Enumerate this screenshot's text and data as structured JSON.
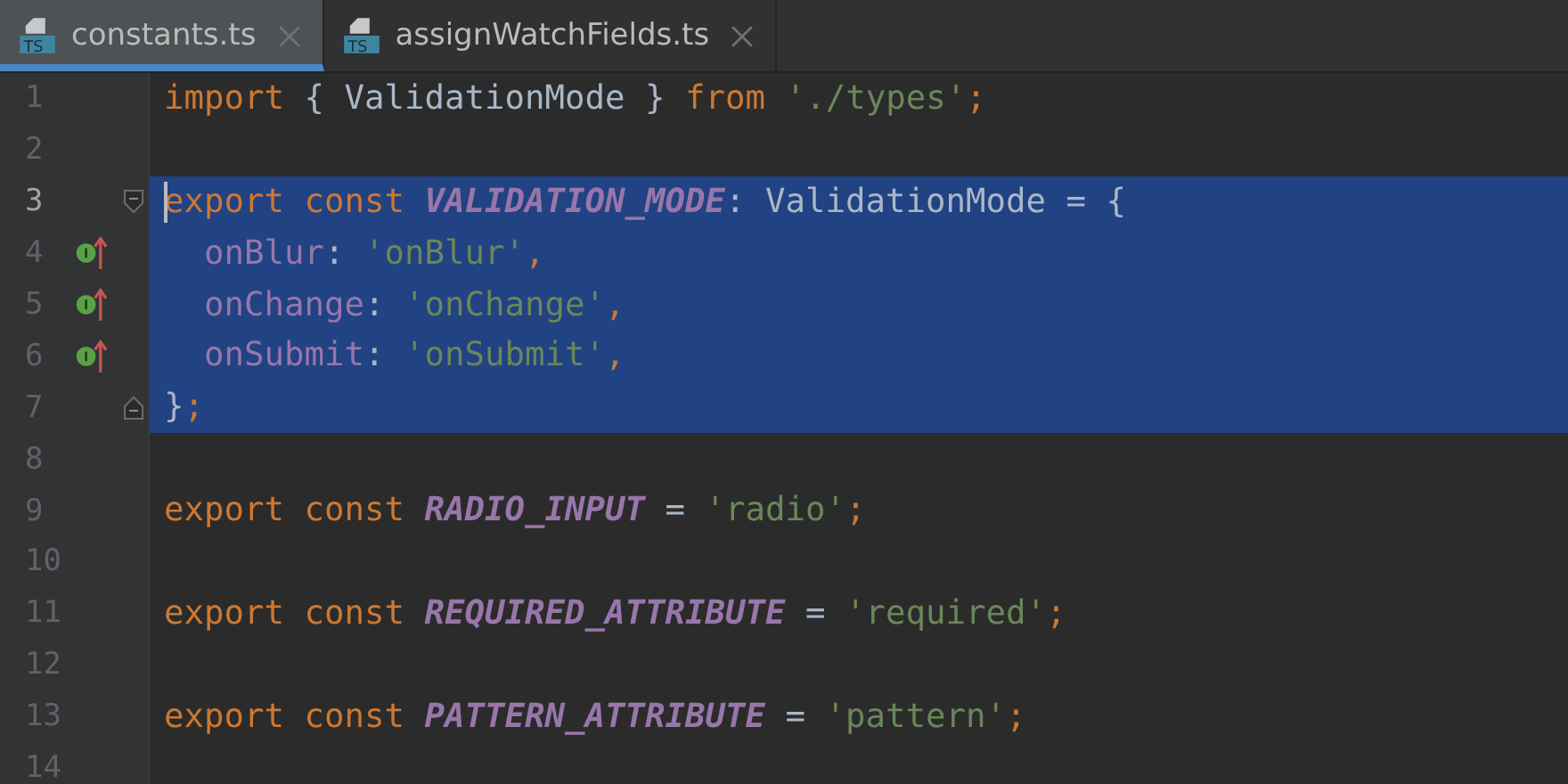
{
  "tabs": [
    {
      "label": "constants.ts",
      "icon_text": "TS",
      "selected": true
    },
    {
      "label": "assignWatchFields.ts",
      "icon_text": "TS",
      "selected": false
    }
  ],
  "lines": [
    {
      "number": "1",
      "current": false,
      "selected": false,
      "tokens": [
        {
          "kind": "keyword",
          "text": "import "
        },
        {
          "kind": "plain",
          "text": "{ ValidationMode } "
        },
        {
          "kind": "keyword",
          "text": "from "
        },
        {
          "kind": "string",
          "text": "'./types'"
        },
        {
          "kind": "keyword",
          "text": ";"
        }
      ]
    },
    {
      "number": "2",
      "current": false,
      "selected": false
    },
    {
      "number": "3",
      "current": true,
      "selected": true,
      "cursor": true,
      "fold_start": true,
      "tokens": [
        {
          "kind": "keyword",
          "text": "export const "
        },
        {
          "kind": "constant",
          "text": "VALIDATION_MODE"
        },
        {
          "kind": "plain",
          "text": ": ValidationMode = {"
        }
      ]
    },
    {
      "number": "4",
      "current": false,
      "selected": true,
      "marker": true,
      "tokens": [
        {
          "kind": "property",
          "text": "  onBlur"
        },
        {
          "kind": "plain",
          "text": ": "
        },
        {
          "kind": "string",
          "text": "'onBlur'"
        },
        {
          "kind": "keyword",
          "text": ","
        }
      ]
    },
    {
      "number": "5",
      "current": false,
      "selected": true,
      "marker": true,
      "tokens": [
        {
          "kind": "property",
          "text": "  onChange"
        },
        {
          "kind": "plain",
          "text": ": "
        },
        {
          "kind": "string",
          "text": "'onChange'"
        },
        {
          "kind": "keyword",
          "text": ","
        }
      ]
    },
    {
      "number": "6",
      "current": false,
      "selected": true,
      "marker": true,
      "tokens": [
        {
          "kind": "property",
          "text": "  onSubmit"
        },
        {
          "kind": "plain",
          "text": ": "
        },
        {
          "kind": "string",
          "text": "'onSubmit'"
        },
        {
          "kind": "keyword",
          "text": ","
        }
      ]
    },
    {
      "number": "7",
      "current": false,
      "selected": true,
      "fold_end": true,
      "tokens": [
        {
          "kind": "plain",
          "text": "}"
        },
        {
          "kind": "keyword",
          "text": ";"
        }
      ]
    },
    {
      "number": "8",
      "current": false,
      "selected": false
    },
    {
      "number": "9",
      "current": false,
      "selected": false,
      "tokens": [
        {
          "kind": "keyword",
          "text": "export const "
        },
        {
          "kind": "constant",
          "text": "RADIO_INPUT"
        },
        {
          "kind": "plain",
          "text": " = "
        },
        {
          "kind": "string",
          "text": "'radio'"
        },
        {
          "kind": "keyword",
          "text": ";"
        }
      ]
    },
    {
      "number": "10",
      "current": false,
      "selected": false
    },
    {
      "number": "11",
      "current": false,
      "selected": false,
      "tokens": [
        {
          "kind": "keyword",
          "text": "export const "
        },
        {
          "kind": "constant",
          "text": "REQUIRED_ATTRIBUTE"
        },
        {
          "kind": "plain",
          "text": " = "
        },
        {
          "kind": "string",
          "text": "'required'"
        },
        {
          "kind": "keyword",
          "text": ";"
        }
      ]
    },
    {
      "number": "12",
      "current": false,
      "selected": false
    },
    {
      "number": "13",
      "current": false,
      "selected": false,
      "tokens": [
        {
          "kind": "keyword",
          "text": "export const "
        },
        {
          "kind": "constant",
          "text": "PATTERN_ATTRIBUTE"
        },
        {
          "kind": "plain",
          "text": " = "
        },
        {
          "kind": "string",
          "text": "'pattern'"
        },
        {
          "kind": "keyword",
          "text": ";"
        }
      ]
    },
    {
      "number": "14",
      "current": false,
      "selected": false
    }
  ]
}
